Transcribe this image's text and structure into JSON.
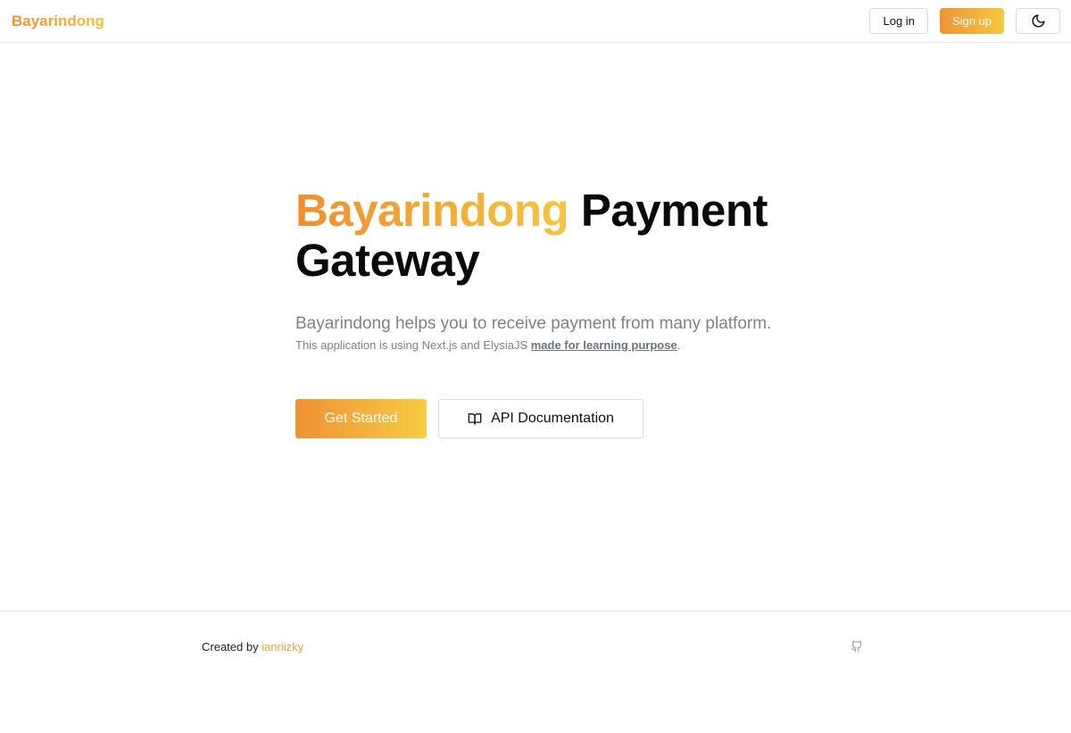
{
  "header": {
    "brand": "Bayarindong",
    "login_label": "Log in",
    "signup_label": "Sign up",
    "theme_icon": "moon-icon"
  },
  "hero": {
    "title_accent": "Bayarindong",
    "title_rest": " Payment Gateway",
    "subtitle": "Bayarindong helps you to receive payment from many platform.",
    "note_prefix": "This application is using Next.js and ElysiaJS ",
    "note_link": "made for learning purpose",
    "note_suffix": ".",
    "get_started_label": "Get Started",
    "docs_label": "API Documentation",
    "docs_icon": "book-icon"
  },
  "footer": {
    "created_by": "Created by ",
    "author": "ianriizky",
    "github_icon": "github-icon"
  },
  "colors": {
    "accent_start": "#ee8f2f",
    "accent_end": "#f6c840",
    "muted_text": "#7c8291",
    "border": "#e5e7eb"
  }
}
